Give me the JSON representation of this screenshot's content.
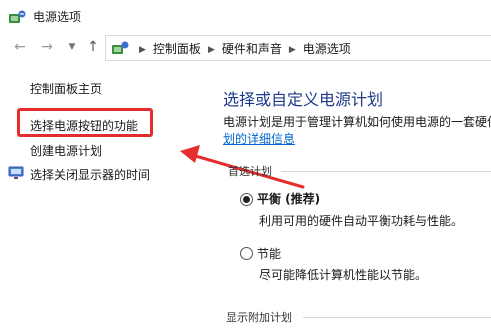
{
  "window": {
    "title": "电源选项"
  },
  "nav": {
    "back_icon": "back-arrow-icon",
    "forward_icon": "forward-arrow-icon",
    "recent_icon": "chevron-down-icon",
    "up_icon": "up-arrow-icon",
    "breadcrumbs": [
      "控制面板",
      "硬件和声音",
      "电源选项"
    ]
  },
  "sidebar": {
    "home": "控制面板主页",
    "items": [
      {
        "label": "选择电源按钮的功能"
      },
      {
        "label": "创建电源计划"
      },
      {
        "label": "选择关闭显示器的时间"
      }
    ]
  },
  "main": {
    "heading": "选择或自定义电源计划",
    "description": "电源计划是用于管理计算机如何使用电源的一套硬件",
    "link": "划的详细信息",
    "section_title": "首选计划",
    "plans": [
      {
        "name": "平衡 (推荐)",
        "description": "利用可用的硬件自动平衡功耗与性能。",
        "selected": true
      },
      {
        "name": "节能",
        "description": "尽可能降低计算机性能以节能。",
        "selected": false
      }
    ],
    "show_more": "显示附加计划"
  },
  "annotation": {
    "color": "#e52d2d"
  }
}
